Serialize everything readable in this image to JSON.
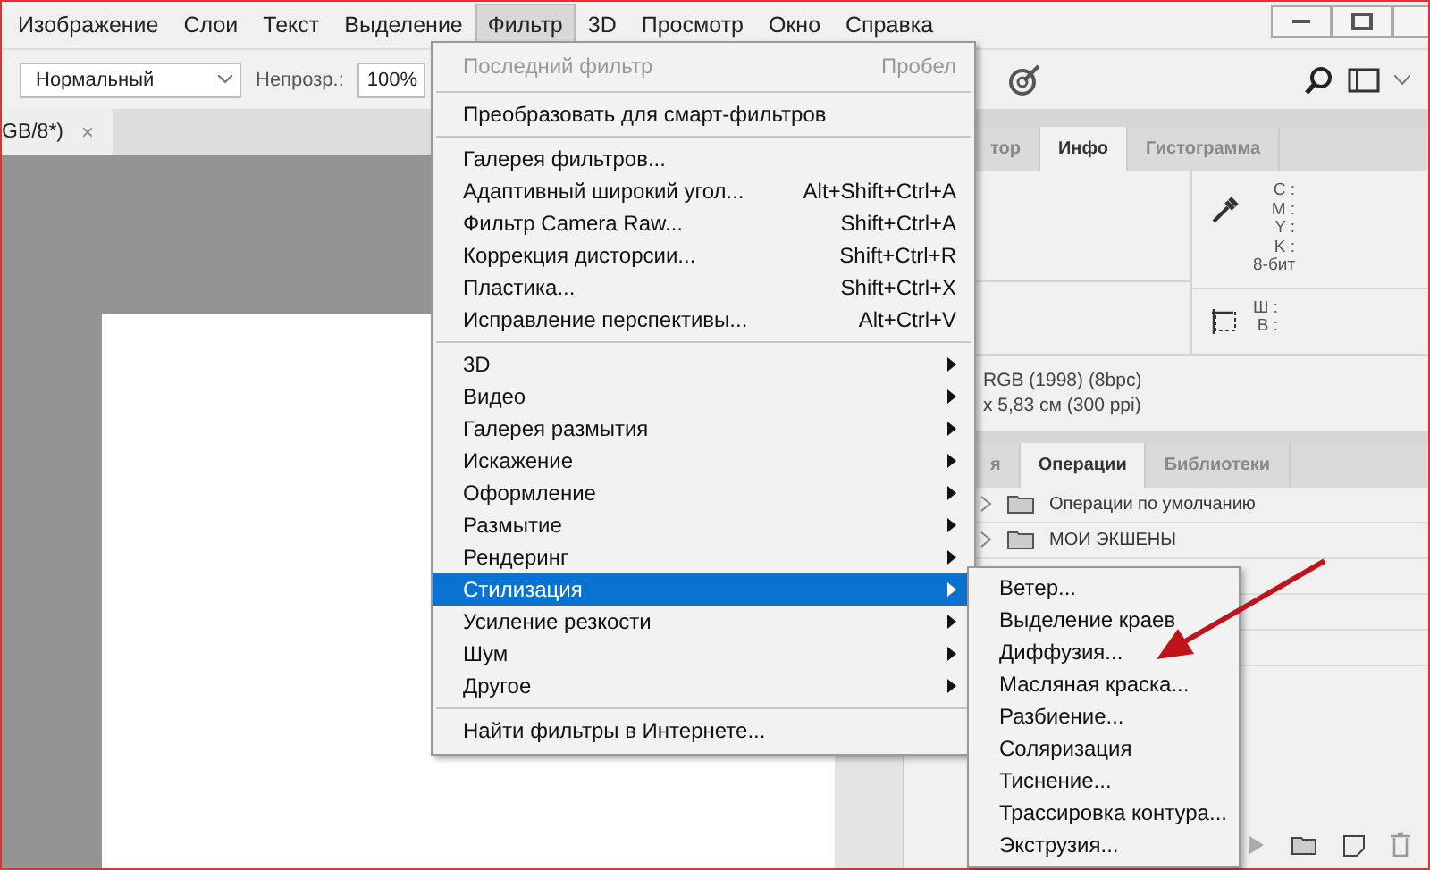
{
  "menubar": [
    {
      "label": "Изображение",
      "selected": false
    },
    {
      "label": "Слои",
      "selected": false
    },
    {
      "label": "Текст",
      "selected": false
    },
    {
      "label": "Выделение",
      "selected": false
    },
    {
      "label": "Фильтр",
      "selected": true
    },
    {
      "label": "3D",
      "selected": false
    },
    {
      "label": "Просмотр",
      "selected": false
    },
    {
      "label": "Окно",
      "selected": false
    },
    {
      "label": "Справка",
      "selected": false
    }
  ],
  "options_bar": {
    "blend_mode": "Нормальный",
    "opacity_label": "Непрозр.:",
    "opacity": "100%"
  },
  "document_tab": {
    "title": "GB/8*)",
    "close": "×"
  },
  "info_panel": {
    "tabs": [
      {
        "label": "тор",
        "selected": false
      },
      {
        "label": "Инфо",
        "selected": true
      },
      {
        "label": "Гистограмма",
        "selected": false
      }
    ],
    "color_readouts": [
      "C :",
      "M :",
      "Y :",
      "K :",
      "8-бит"
    ],
    "size_readouts": [
      "Ш :",
      "В :"
    ],
    "doc_info": [
      "RGB (1998) (8bpc)",
      "x 5,83 см (300 ppi)"
    ]
  },
  "actions_panel": {
    "tabs": [
      {
        "label": "я",
        "selected": false
      },
      {
        "label": "Операции",
        "selected": true
      },
      {
        "label": "Библиотеки",
        "selected": false
      }
    ],
    "rows": [
      "Операции по умолчанию",
      "МОИ  ЭКШЕНЫ"
    ]
  },
  "filter_menu": {
    "items": [
      {
        "kind": "item",
        "label": "Последний фильтр",
        "shortcut": "Пробел",
        "disabled": true,
        "selected": false
      },
      {
        "kind": "separator"
      },
      {
        "kind": "item",
        "label": "Преобразовать для смарт-фильтров",
        "disabled": false,
        "selected": false
      },
      {
        "kind": "separator"
      },
      {
        "kind": "item",
        "label": "Галерея фильтров...",
        "disabled": false,
        "selected": false
      },
      {
        "kind": "item",
        "label": "Адаптивный широкий угол...",
        "shortcut": "Alt+Shift+Ctrl+A",
        "disabled": false,
        "selected": false
      },
      {
        "kind": "item",
        "label": "Фильтр Camera Raw...",
        "shortcut": "Shift+Ctrl+A",
        "disabled": false,
        "selected": false
      },
      {
        "kind": "item",
        "label": "Коррекция дисторсии...",
        "shortcut": "Shift+Ctrl+R",
        "disabled": false,
        "selected": false
      },
      {
        "kind": "item",
        "label": "Пластика...",
        "shortcut": "Shift+Ctrl+X",
        "disabled": false,
        "selected": false
      },
      {
        "kind": "item",
        "label": "Исправление перспективы...",
        "shortcut": "Alt+Ctrl+V",
        "disabled": false,
        "selected": false
      },
      {
        "kind": "separator"
      },
      {
        "kind": "submenu",
        "label": "3D",
        "disabled": false,
        "selected": false
      },
      {
        "kind": "submenu",
        "label": "Видео",
        "disabled": false,
        "selected": false
      },
      {
        "kind": "submenu",
        "label": "Галерея размытия",
        "disabled": false,
        "selected": false
      },
      {
        "kind": "submenu",
        "label": "Искажение",
        "disabled": false,
        "selected": false
      },
      {
        "kind": "submenu",
        "label": "Оформление",
        "disabled": false,
        "selected": false
      },
      {
        "kind": "submenu",
        "label": "Размытие",
        "disabled": false,
        "selected": false
      },
      {
        "kind": "submenu",
        "label": "Рендеринг",
        "disabled": false,
        "selected": false
      },
      {
        "kind": "submenu",
        "label": "Стилизация",
        "disabled": false,
        "selected": true
      },
      {
        "kind": "submenu",
        "label": "Усиление резкости",
        "disabled": false,
        "selected": false
      },
      {
        "kind": "submenu",
        "label": "Шум",
        "disabled": false,
        "selected": false
      },
      {
        "kind": "submenu",
        "label": "Другое",
        "disabled": false,
        "selected": false
      },
      {
        "kind": "separator"
      },
      {
        "kind": "item",
        "label": "Найти фильтры в Интернете...",
        "disabled": false,
        "selected": false
      }
    ]
  },
  "stylize_submenu": {
    "items": [
      "Ветер...",
      "Выделение краев",
      "Диффузия...",
      "Масляная краска...",
      "Разбиение...",
      "Соляризация",
      "Тиснение...",
      "Трассировка контура...",
      "Экструзия..."
    ]
  }
}
